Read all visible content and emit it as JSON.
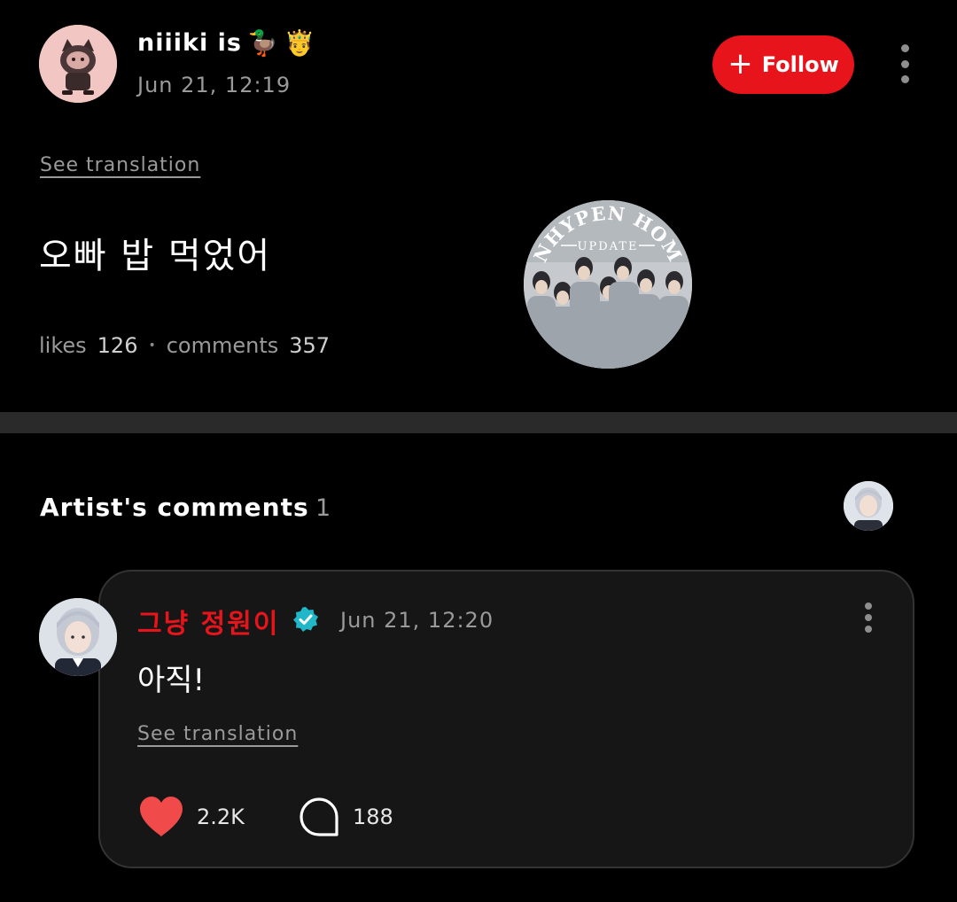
{
  "post": {
    "author": {
      "name": "niiiki is",
      "emojis": [
        "🦆",
        "🤴"
      ],
      "avatar": "cat-character-avatar"
    },
    "timestamp": "Jun 21, 12:19",
    "follow_label": "Follow",
    "see_translation": "See translation",
    "text": "오빠 밥 먹었어",
    "stats": {
      "likes_label": "likes",
      "likes": "126",
      "comments_label": "comments",
      "comments": "357"
    },
    "watermark": {
      "line1": "ENHYPEN HOME",
      "line2": "UPDATE"
    }
  },
  "artist_comments": {
    "title": "Artist's comments",
    "count": "1",
    "comment": {
      "author": "그냥 정원이",
      "verified": true,
      "timestamp": "Jun 21, 12:20",
      "text": "아직!",
      "see_translation": "See translation",
      "likes": "2.2K",
      "replies": "188"
    }
  },
  "colors": {
    "background": "#000000",
    "accent_red": "#e8141c",
    "verified_teal": "#21b6c8",
    "like_red": "#f04a4a",
    "muted_text": "#9a9a9a",
    "card_bg": "#161616"
  }
}
